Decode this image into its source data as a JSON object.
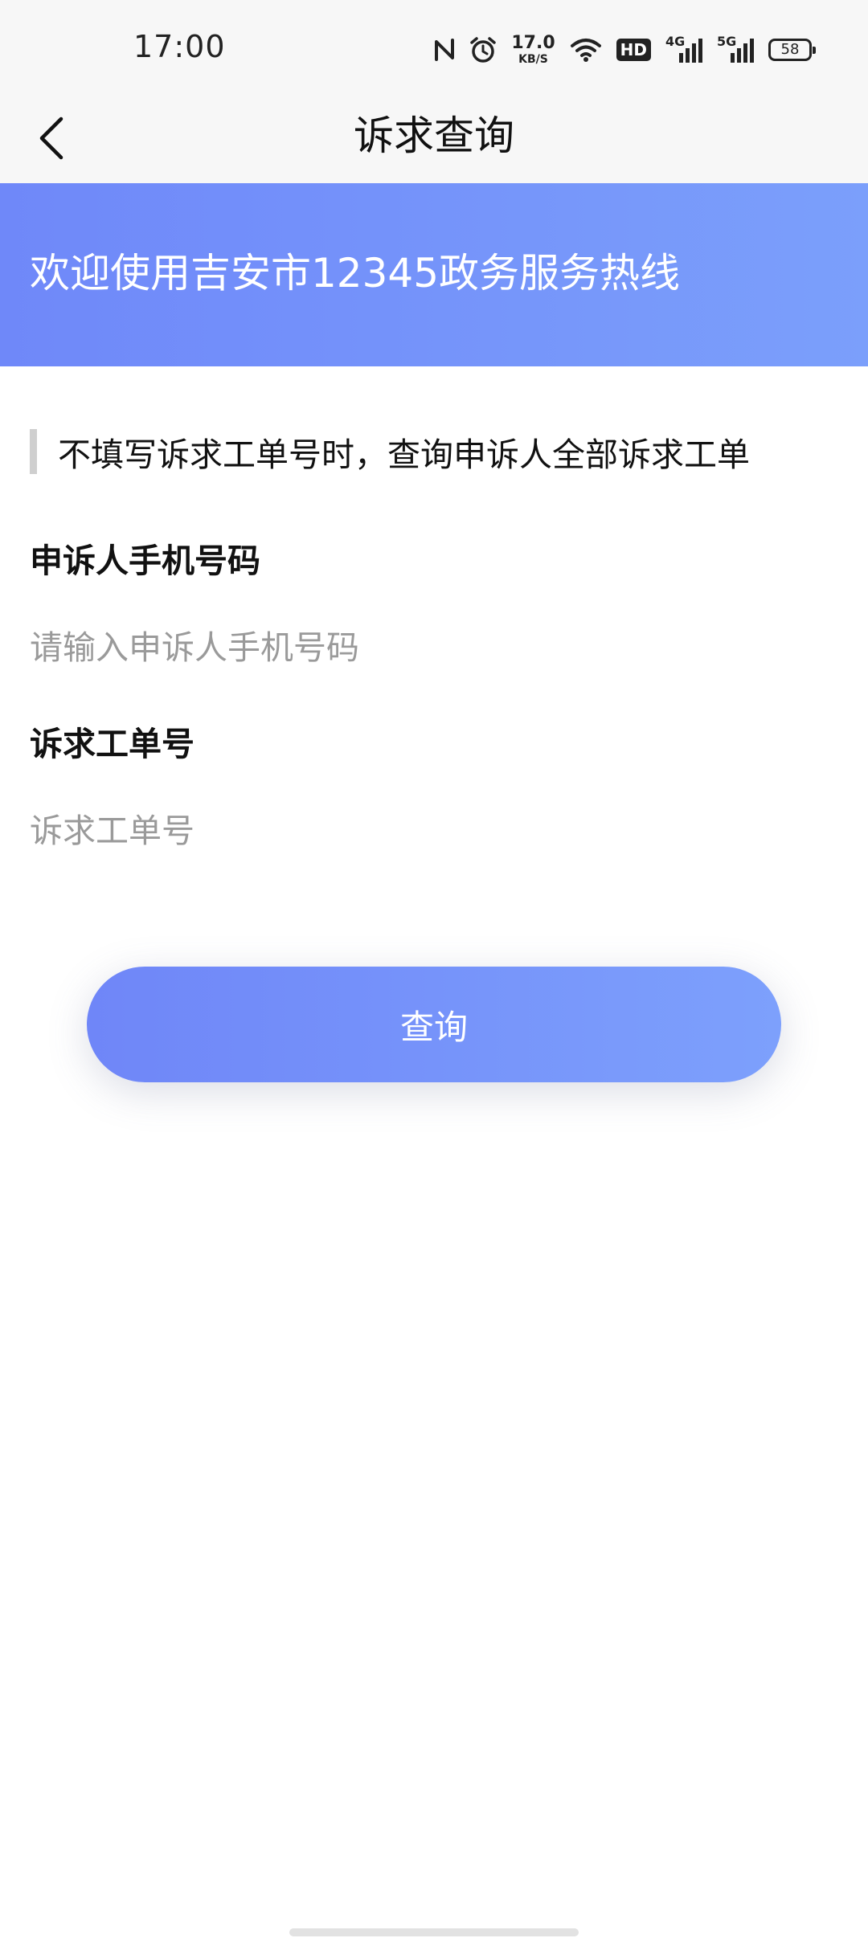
{
  "status_bar": {
    "time": "17:00",
    "speed_value": "17.0",
    "speed_unit": "KB/S",
    "hd_label": "HD",
    "network_1": "4G",
    "network_2": "5G",
    "battery": "58",
    "icons": [
      "nfc-icon",
      "alarm-icon",
      "wifi-icon",
      "signal-icon",
      "battery-icon"
    ]
  },
  "nav": {
    "title": "诉求查询",
    "back_icon": "chevron-left-icon"
  },
  "banner": {
    "text": "欢迎使用吉安市12345政务服务热线",
    "gradient_start": "#6f88f9",
    "gradient_end": "#7b9ffb"
  },
  "notice": {
    "text": "不填写诉求工单号时，查询申诉人全部诉求工单"
  },
  "form": {
    "phone": {
      "label": "申诉人手机号码",
      "placeholder": "请输入申诉人手机号码",
      "value": ""
    },
    "ticket": {
      "label": "诉求工单号",
      "placeholder": "诉求工单号",
      "value": ""
    }
  },
  "query_button": {
    "label": "查询"
  }
}
